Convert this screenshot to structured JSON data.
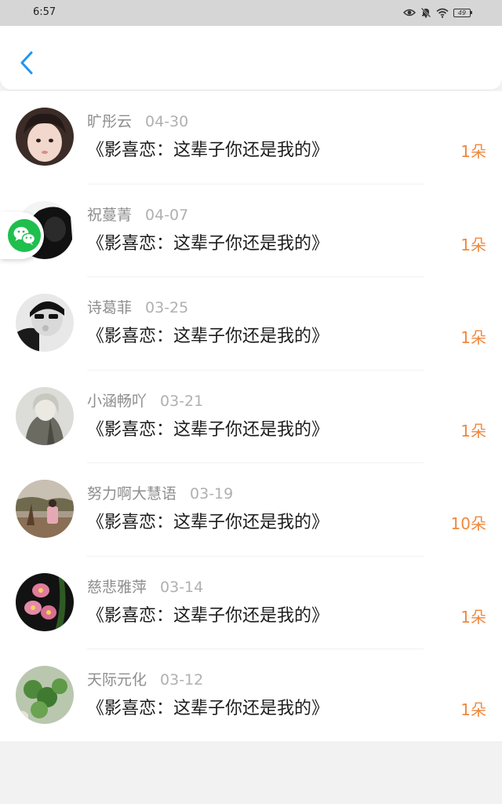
{
  "status_bar": {
    "time": "6:57",
    "battery": "49",
    "icons": [
      "eye-icon",
      "bell-muted-icon",
      "wifi-icon",
      "battery-icon"
    ]
  },
  "header": {
    "back_icon": "chevron-left-icon",
    "accent_color": "#2196f3"
  },
  "floating_button": {
    "icon": "wechat-icon",
    "color": "#1fbf4d"
  },
  "list": {
    "count_color": "#f0883c",
    "items": [
      {
        "name": "旷彤云",
        "date": "04-30",
        "title": "《影喜恋：这辈子你还是我的》",
        "count": "1朵"
      },
      {
        "name": "祝蔓菁",
        "date": "04-07",
        "title": "《影喜恋：这辈子你还是我的》",
        "count": "1朵"
      },
      {
        "name": "诗葛菲",
        "date": "03-25",
        "title": "《影喜恋：这辈子你还是我的》",
        "count": "1朵"
      },
      {
        "name": "小涵畅吖",
        "date": "03-21",
        "title": "《影喜恋：这辈子你还是我的》",
        "count": "1朵"
      },
      {
        "name": "努力啊大慧语",
        "date": "03-19",
        "title": "《影喜恋：这辈子你还是我的》",
        "count": "10朵"
      },
      {
        "name": "慈悲雅萍",
        "date": "03-14",
        "title": "《影喜恋：这辈子你还是我的》",
        "count": "1朵"
      },
      {
        "name": "天际元化",
        "date": "03-12",
        "title": "《影喜恋：这辈子你还是我的》",
        "count": "1朵"
      }
    ]
  }
}
